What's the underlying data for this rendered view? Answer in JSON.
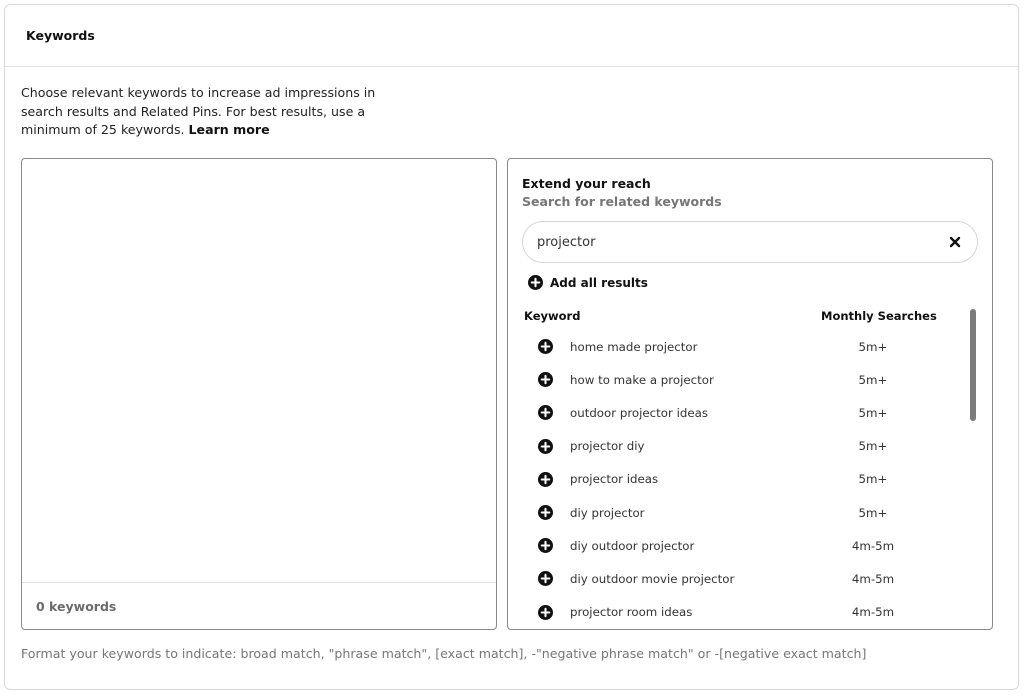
{
  "card": {
    "title": "Keywords"
  },
  "description": {
    "text": "Choose relevant keywords to increase ad impressions in search results and Related Pins. For best results, use a minimum of 25 keywords.",
    "learn_more": "Learn more"
  },
  "left_panel": {
    "textarea_value": "",
    "keyword_count": "0 keywords"
  },
  "right_panel": {
    "title": "Extend your reach",
    "subtitle": "Search for related keywords",
    "search": {
      "value": "projector",
      "clear_icon": "close-icon"
    },
    "add_all_label": "Add all results",
    "table": {
      "columns": [
        "Keyword",
        "Monthly Searches"
      ],
      "rows": [
        {
          "keyword": "home made projector",
          "searches": "5m+"
        },
        {
          "keyword": "how to make a projector",
          "searches": "5m+"
        },
        {
          "keyword": "outdoor projector ideas",
          "searches": "5m+"
        },
        {
          "keyword": "projector diy",
          "searches": "5m+"
        },
        {
          "keyword": "projector ideas",
          "searches": "5m+"
        },
        {
          "keyword": "diy projector",
          "searches": "5m+"
        },
        {
          "keyword": "diy outdoor projector",
          "searches": "4m-5m"
        },
        {
          "keyword": "diy outdoor movie projector",
          "searches": "4m-5m"
        },
        {
          "keyword": "projector room ideas",
          "searches": "4m-5m"
        }
      ]
    }
  },
  "format_hint": "Format your keywords to indicate: broad match, \"phrase match\", [exact match], -\"negative phrase match\" or -[negative exact match]",
  "colors": {
    "text_primary": "#111111",
    "text_secondary": "#767676",
    "border": "#8a8a8a",
    "scrollbar": "#7a7a7a"
  }
}
